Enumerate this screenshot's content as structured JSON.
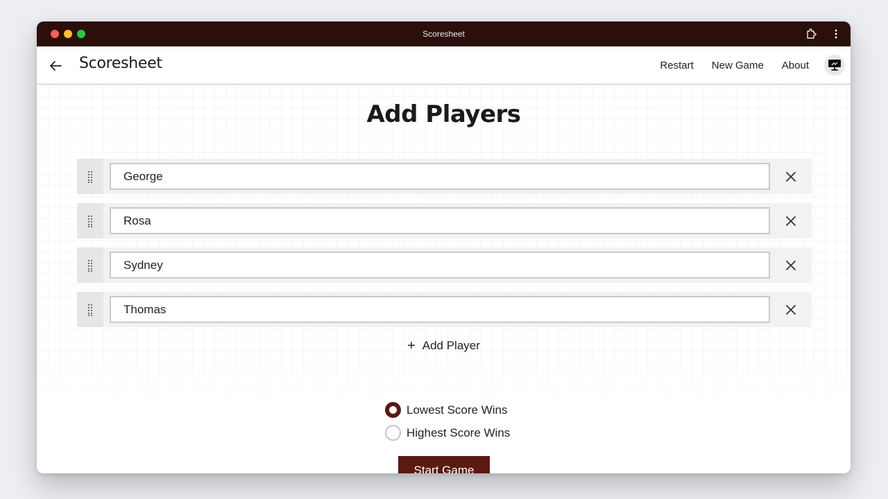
{
  "window": {
    "title": "Scoresheet"
  },
  "appbar": {
    "title": "Scoresheet",
    "nav": [
      {
        "label": "Restart"
      },
      {
        "label": "New Game"
      },
      {
        "label": "About"
      }
    ],
    "display_icon": "monitor-icon"
  },
  "main": {
    "heading": "Add Players",
    "players": [
      {
        "name": "George"
      },
      {
        "name": "Rosa"
      },
      {
        "name": "Sydney"
      },
      {
        "name": "Thomas"
      }
    ],
    "add_player_label": "Add Player",
    "scoring_options": [
      {
        "label": "Lowest Score Wins",
        "selected": true
      },
      {
        "label": "Highest Score Wins",
        "selected": false
      }
    ],
    "start_button_label": "Start Game"
  },
  "colors": {
    "titlebar": "#2b0f0b",
    "accent": "#5a1a12",
    "divider": "#dbb3b3"
  }
}
